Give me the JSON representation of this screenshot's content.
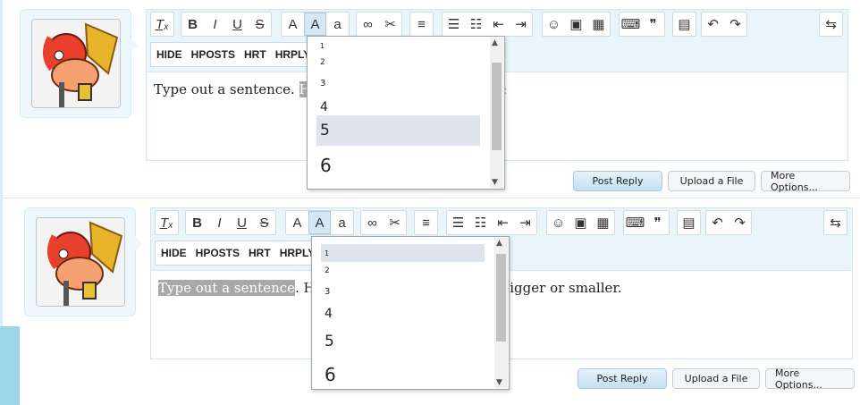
{
  "posts": [
    {
      "toolbar2": [
        "HIDE",
        "HPOSTS",
        "HRT",
        "HRPLY"
      ],
      "content": {
        "before": "Type out a sentence. ",
        "highlight": "Highl",
        "after": "",
        "trail": ":"
      },
      "buttons": {
        "post": "Post Reply",
        "upload": "Upload a File",
        "more": "More Options..."
      },
      "dropdown": {
        "options": [
          "1",
          "2",
          "3",
          "4",
          "5",
          "6"
        ],
        "selected": "5"
      }
    },
    {
      "toolbar2": [
        "HIDE",
        "HPOSTS",
        "HRT",
        "HRPLY"
      ],
      "content": {
        "before": "",
        "highlight": "Type out a sentence",
        "after": ". High",
        "trail": "e bigger or smaller."
      },
      "buttons": {
        "post": "Post Reply",
        "upload": "Upload a File",
        "more": "More Options..."
      },
      "dropdown": {
        "options": [
          "1",
          "2",
          "3",
          "4",
          "5",
          "6"
        ],
        "selected": "1"
      }
    }
  ],
  "icons": [
    "remove-format-icon",
    "bold-icon",
    "italic-icon",
    "underline-icon",
    "strikethrough-icon",
    "text-color-icon",
    "font-size-icon",
    "font-family-icon",
    "link-icon",
    "unlink-icon",
    "align-icon",
    "bullet-list-icon",
    "numbered-list-icon",
    "outdent-icon",
    "indent-icon",
    "smilies-icon",
    "image-icon",
    "media-icon",
    "code-icon",
    "quote-icon",
    "save-draft-icon",
    "undo-icon",
    "redo-icon",
    "toggle-bbcode-icon"
  ],
  "colors": {
    "accent": "#e9f5fb",
    "selection": "#dde4ee",
    "highlight": "#a8a8a8"
  }
}
